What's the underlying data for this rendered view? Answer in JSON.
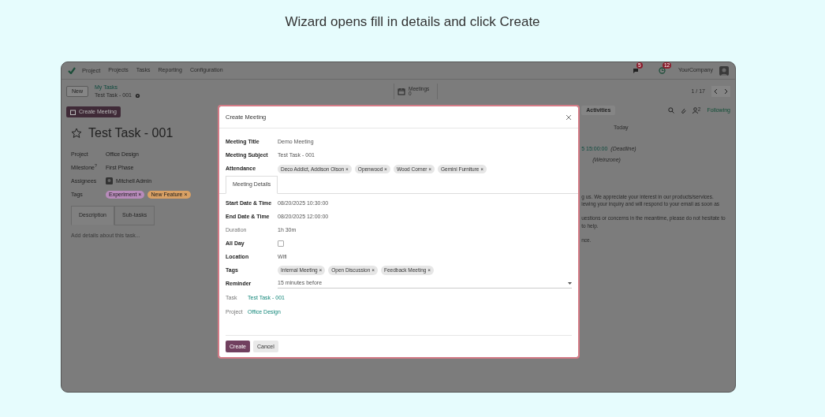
{
  "caption": "Wizard opens fill in details and click Create",
  "navbar": {
    "brand": "Project",
    "menu": [
      "Projects",
      "Tasks",
      "Reporting",
      "Configuration"
    ],
    "messages_count": "5",
    "activities_count": "12",
    "company": "YourCompany"
  },
  "control_panel": {
    "new_button": "New",
    "breadcrumb": "My Tasks",
    "record": "Test Task - 001",
    "stat_label": "Meetings",
    "stat_count": "0",
    "pager": "1 / 17"
  },
  "form": {
    "action_button": "Create Meeting",
    "title": "Test Task - 001",
    "starred": false,
    "fields": [
      {
        "kind": "text",
        "label": "Project",
        "value": "Office Design"
      },
      {
        "kind": "text",
        "label": "Milestone$^{?}$",
        "value": "First Phase"
      },
      {
        "kind": "user",
        "label": "Assignees",
        "value": "Mitchell Admin"
      },
      {
        "kind": "tags",
        "label": "Tags",
        "tags": [
          {
            "label": "Experiment ×",
            "color": "#b88bbb"
          },
          {
            "label": "New Feature ×",
            "color": "#d8a064"
          }
        ]
      }
    ],
    "tabs": [
      {
        "label": "Description",
        "selected": true
      },
      {
        "label": "Sub-tasks",
        "selected": false
      }
    ],
    "description_placeholder": "Add details about this task..."
  },
  "chatter": {
    "activities_button": "Activities",
    "followers_count": "2",
    "follow_label": "Following",
    "date_separator": "Today",
    "deadline": "5 15:00:00",
    "deadline_note": "(Deadline)",
    "user_note": "(Weinzone)",
    "paragraphs": [
      [
        "g us. We appreciate your interest in our products/services.",
        "iewing your inquiry and will respond to your email as soon as"
      ],
      [
        "uestions or concerns in the meantime, please do not hesitate to",
        "to help."
      ],
      [
        "nce."
      ]
    ]
  },
  "modal": {
    "title": "Create Meeting",
    "fields": [
      {
        "kind": "text",
        "label": "Meeting Title",
        "value": "Demo Meeting"
      },
      {
        "kind": "text",
        "label": "Meeting Subject",
        "value": "Test Task - 001"
      },
      {
        "kind": "tags",
        "label": "Attendance",
        "tags": [
          "Deco Addict, Addison Olson ×",
          "Openwood ×",
          "Wood Corner ×",
          "Gemini Furniture ×"
        ]
      }
    ],
    "tabs": [
      {
        "label": "Meeting Details",
        "selected": true
      }
    ],
    "details": [
      {
        "kind": "text",
        "label": "Start Date & Time",
        "value": "08/20/2025 10:30:00"
      },
      {
        "kind": "text",
        "label": "End Date & Time",
        "value": "08/20/2025 12:00:00"
      },
      {
        "kind": "readonly",
        "label": "Duration",
        "value": "1h 30m"
      },
      {
        "kind": "checkbox",
        "label": "All Day",
        "checked": false
      },
      {
        "kind": "text",
        "label": "Location",
        "value": "Wifi"
      },
      {
        "kind": "tags",
        "label": "Tags",
        "tags": [
          "Internal Meeting ×",
          "Open Discussion ×",
          "Feedback Meeting ×"
        ]
      },
      {
        "kind": "select",
        "label": "Reminder",
        "value": "15 minutes before"
      },
      {
        "kind": "link",
        "label": "Task",
        "value": "Test Task - 001"
      },
      {
        "kind": "link",
        "label": "Project",
        "value": "Office Design"
      }
    ],
    "buttons": [
      {
        "kind": "primary",
        "label": "Create"
      },
      {
        "kind": "secondary",
        "label": "Cancel"
      }
    ]
  }
}
